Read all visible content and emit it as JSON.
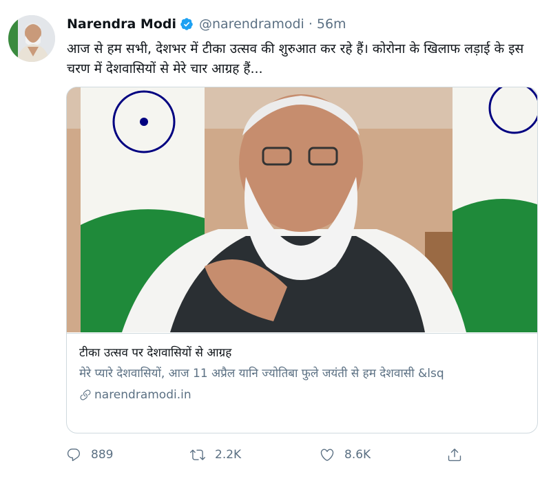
{
  "tweet": {
    "author_name": "Narendra Modi",
    "handle": "@narendramodi",
    "separator": "·",
    "time": "56m",
    "text": "आज से हम सभी, देशभर में टीका उत्सव की शुरुआत कर रहे हैं। कोरोना के खिलाफ लड़ाई के इस चरण में देशवासियों से मेरे चार आग्रह हैं...",
    "verified_icon": "verified-badge-icon",
    "avatar_icon": "avatar"
  },
  "card": {
    "image_icon": "article-photo",
    "title": "टीका उत्सव पर देशवासियों से आग्रह",
    "description": "मेरे प्यारे देशवासियों, आज 11 अप्रैल यानि ज्योतिबा फुले जयंती से हम देशवासी &lsq",
    "domain": "narendramodi.in",
    "link_icon": "link-icon"
  },
  "actions": {
    "reply_count": "889",
    "retweet_count": "2.2K",
    "like_count": "8.6K",
    "reply_icon": "reply-icon",
    "retweet_icon": "retweet-icon",
    "like_icon": "like-icon",
    "share_icon": "share-icon"
  },
  "colors": {
    "verified": "#1da1f2",
    "secondary_text": "#5b7083",
    "border": "#cfd9de",
    "saffron": "#ff9933",
    "green": "#138808",
    "chakra": "#000080"
  }
}
